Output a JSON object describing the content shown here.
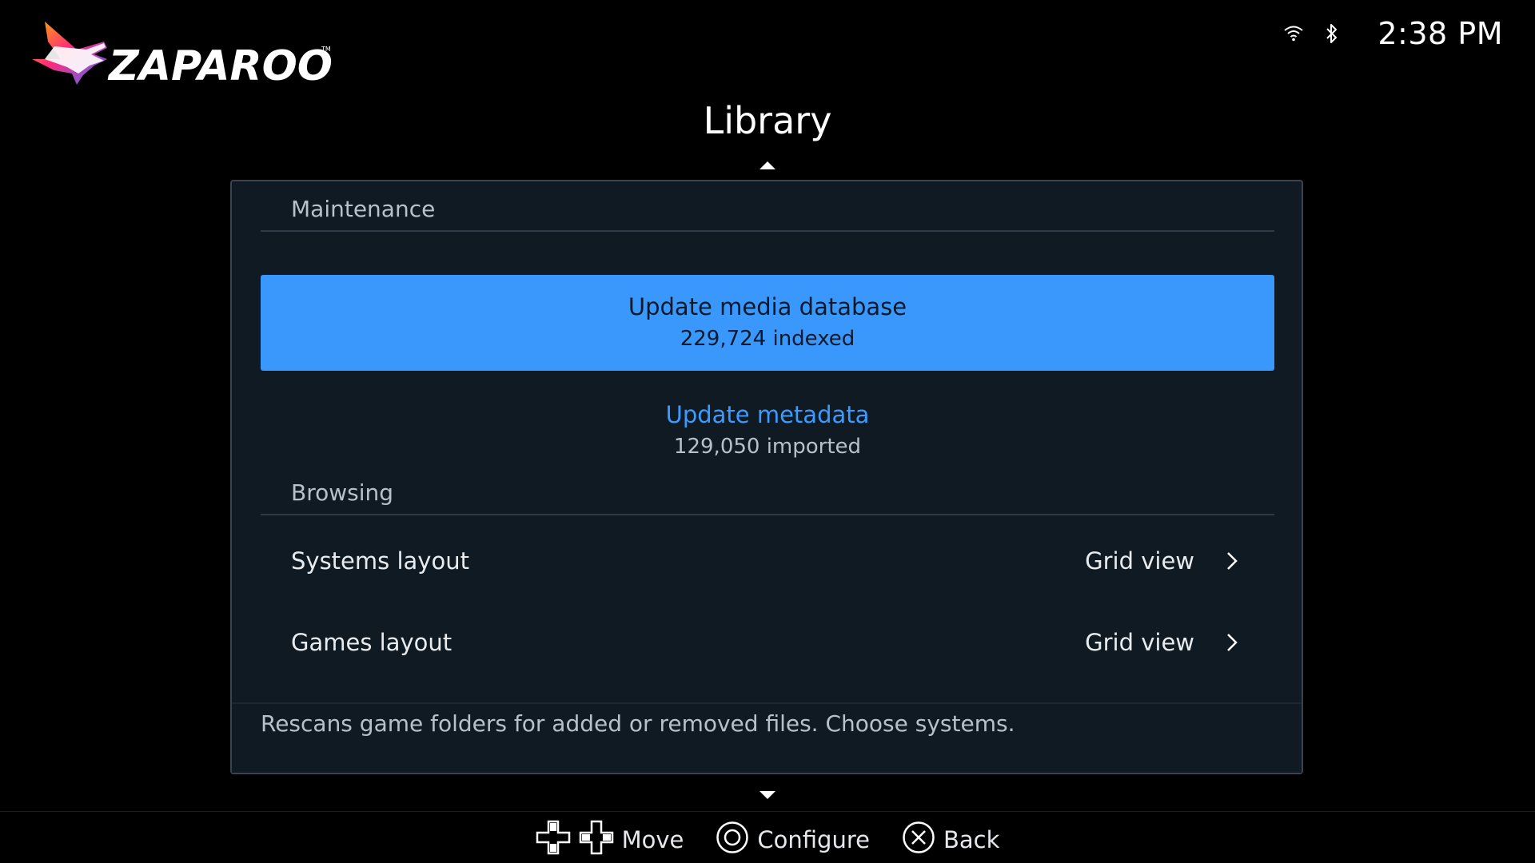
{
  "header": {
    "logo_text": "ZAPAROO",
    "status": {
      "wifi_icon": "wifi-icon",
      "bluetooth_icon": "bluetooth-icon",
      "time": "2:38 PM"
    }
  },
  "page": {
    "title": "Library"
  },
  "sections": {
    "maintenance": {
      "header": "Maintenance",
      "update_media": {
        "title": "Update media database",
        "subtitle": "229,724 indexed"
      },
      "update_metadata": {
        "title": "Update metadata",
        "subtitle": "129,050 imported"
      }
    },
    "browsing": {
      "header": "Browsing",
      "rows": [
        {
          "label": "Systems layout",
          "value": "Grid view"
        },
        {
          "label": "Games layout",
          "value": "Grid view"
        }
      ]
    }
  },
  "help_text": "Rescans game folders for added or removed files. Choose systems.",
  "footer": {
    "move": "Move",
    "configure": "Configure",
    "back": "Back"
  },
  "colors": {
    "background": "#000000",
    "panel": "#101a22",
    "accent": "#3a98fd",
    "link": "#3d9bff"
  }
}
